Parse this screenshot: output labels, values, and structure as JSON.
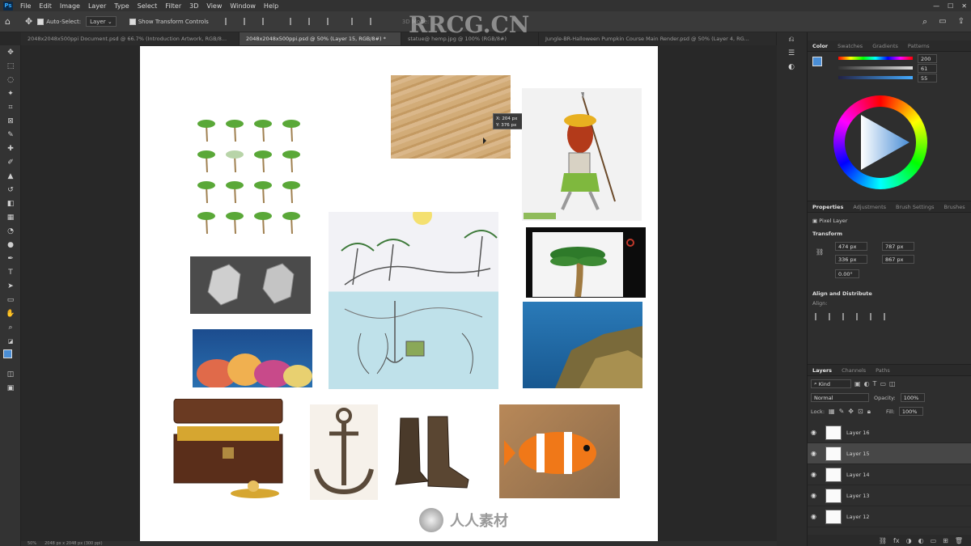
{
  "menu": [
    "File",
    "Edit",
    "Image",
    "Layer",
    "Type",
    "Select",
    "Filter",
    "3D",
    "View",
    "Window",
    "Help"
  ],
  "app_logo": "Ps",
  "options": {
    "auto_select_label": "Auto-Select:",
    "auto_select_value": "Layer",
    "show_transform_label": "Show Transform Controls",
    "mode_3d": "3D Mode:"
  },
  "tabs": [
    {
      "label": "2048x2048x500ppi Document.psd @ 66.7% (Introduction Artwork, RGB/8...",
      "active": false
    },
    {
      "label": "2048x2048x500ppi.psd @ 50% (Layer 15, RGB/8#) *",
      "active": true
    },
    {
      "label": "statue@ hemp.jpg @ 100% (RGB/8#)",
      "active": false
    },
    {
      "label": "Jungle-BR-Halloween Pumpkin Course Main Render.psd @ 50% (Layer 4, RG...",
      "active": false
    }
  ],
  "watermark": {
    "top": "RRCG.CN",
    "logo_text": "人人素材"
  },
  "tooltip": {
    "x": "X: 204 px",
    "y": "Y: 376 px"
  },
  "panels": {
    "color_tabs": [
      "Color",
      "Swatches",
      "Gradients",
      "Patterns"
    ],
    "color_values": [
      {
        "label": "R",
        "value": "200"
      },
      {
        "label": "G",
        "value": "61"
      },
      {
        "label": "B",
        "value": "55"
      }
    ],
    "props_tabs": [
      "Properties",
      "Adjustments",
      "Brush Settings",
      "Brushes"
    ],
    "pixel_layer": "Pixel Layer",
    "transform_label": "Transform",
    "w": "474 px",
    "h": "336 px",
    "x": "787 px",
    "y": "867 px",
    "angle": "0.00°",
    "align_label": "Align and Distribute",
    "align_sub": "Align:",
    "layers_tabs": [
      "Layers",
      "Channels",
      "Paths"
    ],
    "kind": "Kind",
    "blend_mode": "Normal",
    "opacity_label": "Opacity:",
    "opacity_value": "100%",
    "lock_label": "Lock:",
    "fill_label": "Fill:",
    "fill_value": "100%",
    "layers": [
      {
        "name": "Layer 16",
        "selected": false
      },
      {
        "name": "Layer 15",
        "selected": true
      },
      {
        "name": "Layer 14",
        "selected": false
      },
      {
        "name": "Layer 13",
        "selected": false
      },
      {
        "name": "Layer 12",
        "selected": false
      }
    ]
  },
  "status": {
    "zoom": "50%",
    "doc": "2048 px x 2048 px (300 ppi)"
  },
  "colors": {
    "accent": "#31a8ff",
    "fg": "#4a8ed6",
    "bg": "#e6a040"
  }
}
